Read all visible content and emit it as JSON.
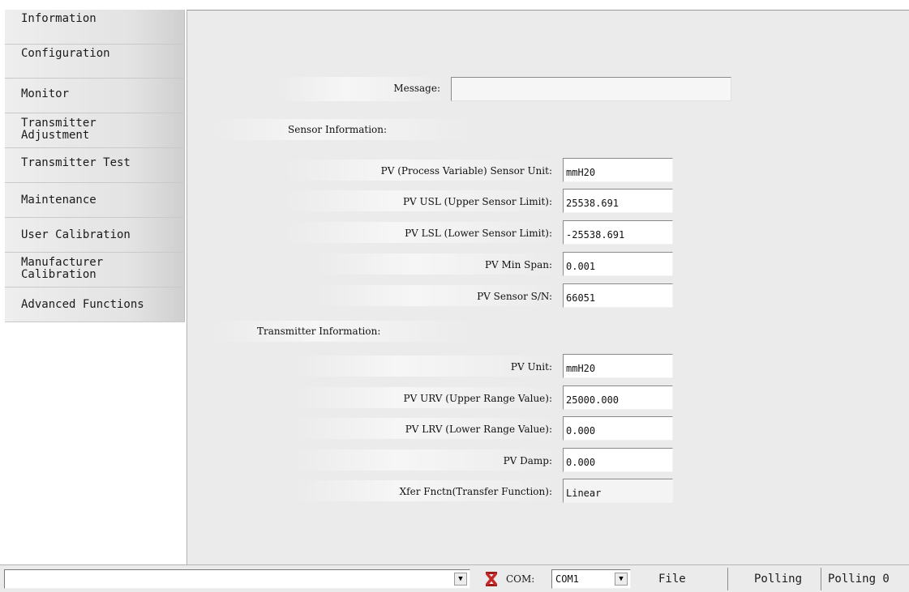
{
  "sidebar": {
    "items": [
      {
        "label": "Information"
      },
      {
        "label": "Configuration"
      },
      {
        "label": "Monitor"
      },
      {
        "label": "Transmitter\nAdjustment"
      },
      {
        "label": "Transmitter Test"
      },
      {
        "label": "Maintenance"
      },
      {
        "label": "User Calibration"
      },
      {
        "label": "Manufacturer\nCalibration"
      },
      {
        "label": "Advanced Functions"
      }
    ]
  },
  "main": {
    "message": {
      "label": "Message:",
      "value": ""
    },
    "sensor": {
      "heading": "Sensor Information:",
      "unit": {
        "label": "PV (Process Variable) Sensor Unit:",
        "value": "mmH20"
      },
      "usl": {
        "label": "PV  USL (Upper Sensor Limit):",
        "value": "25538.691"
      },
      "lsl": {
        "label": "PV LSL (Lower Sensor Limit):",
        "value": "-25538.691"
      },
      "min_span": {
        "label": "PV Min Span:",
        "value": "0.001"
      },
      "serial": {
        "label": "PV Sensor S/N:",
        "value": "66051"
      }
    },
    "transmitter": {
      "heading": "Transmitter Information:",
      "unit": {
        "label": "PV Unit:",
        "value": "mmH20"
      },
      "urv": {
        "label": "PV URV (Upper Range Value):",
        "value": "25000.000"
      },
      "lrv": {
        "label": "PV LRV (Lower Range Value):",
        "value": "0.000"
      },
      "damp": {
        "label": "PV Damp:",
        "value": "0.000"
      },
      "xfer": {
        "label": "Xfer Fnctn(Transfer Function):",
        "value": "Linear"
      }
    }
  },
  "statusbar": {
    "device_select_value": "",
    "com_label": "COM:",
    "com_value": "COM1",
    "file_label": "File",
    "polling_label": "Polling",
    "polling_count": "Polling 0"
  },
  "colors": {
    "panel_bg": "#ebebeb",
    "status_icon_red": "#c62828"
  },
  "icons": [
    "dropdown-arrow-icon",
    "disconnected-x-icon"
  ]
}
